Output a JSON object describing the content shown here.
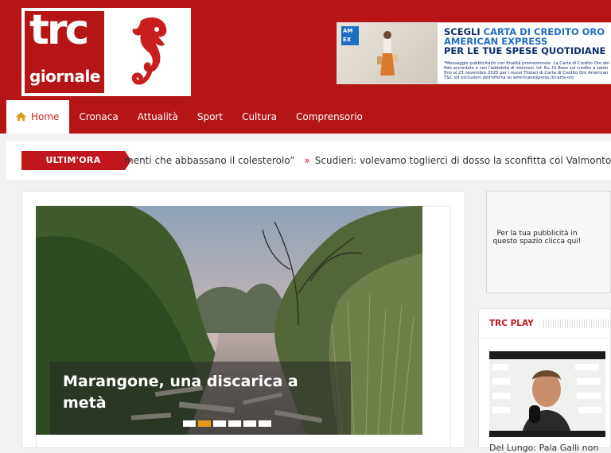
{
  "logo": {
    "line1": "trc",
    "line2": "giornale"
  },
  "ad": {
    "brand": "AM EX",
    "headline_prefix": "SCEGLI ",
    "headline_highlight": "CARTA DI CREDITO ORO",
    "headline_line2": "AMERICAN EXPRESS",
    "headline_line3": "PER LE TUE SPESE QUOTIDIANE",
    "small_print": "*Messaggio pubblicitario con finalità promozionale. La Carta di Credito Oro dei fido accordato e con l'addebito di interessi. Inf. Eu. Di Base sul credito a saldo fino al 23 novembre 2025 per i nuovi Titolari di Carta di Credito Oro American T&C ed esclusioni dell'offerta su americanexpress.it/carta-oro"
  },
  "nav": {
    "items": [
      {
        "label": "Home",
        "icon": "home-icon",
        "active": true
      },
      {
        "label": "Cronaca"
      },
      {
        "label": "Attualità"
      },
      {
        "label": "Sport"
      },
      {
        "label": "Cultura"
      },
      {
        "label": "Comprensorio"
      }
    ]
  },
  "ticker": {
    "label": "ULTIM'ORA",
    "item1": "menti che abbassano il colesterolo”",
    "separator": "»",
    "item2": "Scudieri: volevamo toglierci di dosso la sconfitta col Valmontone"
  },
  "slider": {
    "title": "Marangone, una discarica a metà",
    "slides_count": 6,
    "active_index": 1
  },
  "side_ad": {
    "text": "Per la tua pubblicità in questo spazio clicca qui!"
  },
  "trc_play": {
    "title": "TRC PLAY",
    "video_caption": "Del Lungo: Pala Galli non"
  },
  "colors": {
    "brand_red": "#b51515",
    "accent_orange": "#e39b1a",
    "ticker_red": "#c1161b"
  }
}
